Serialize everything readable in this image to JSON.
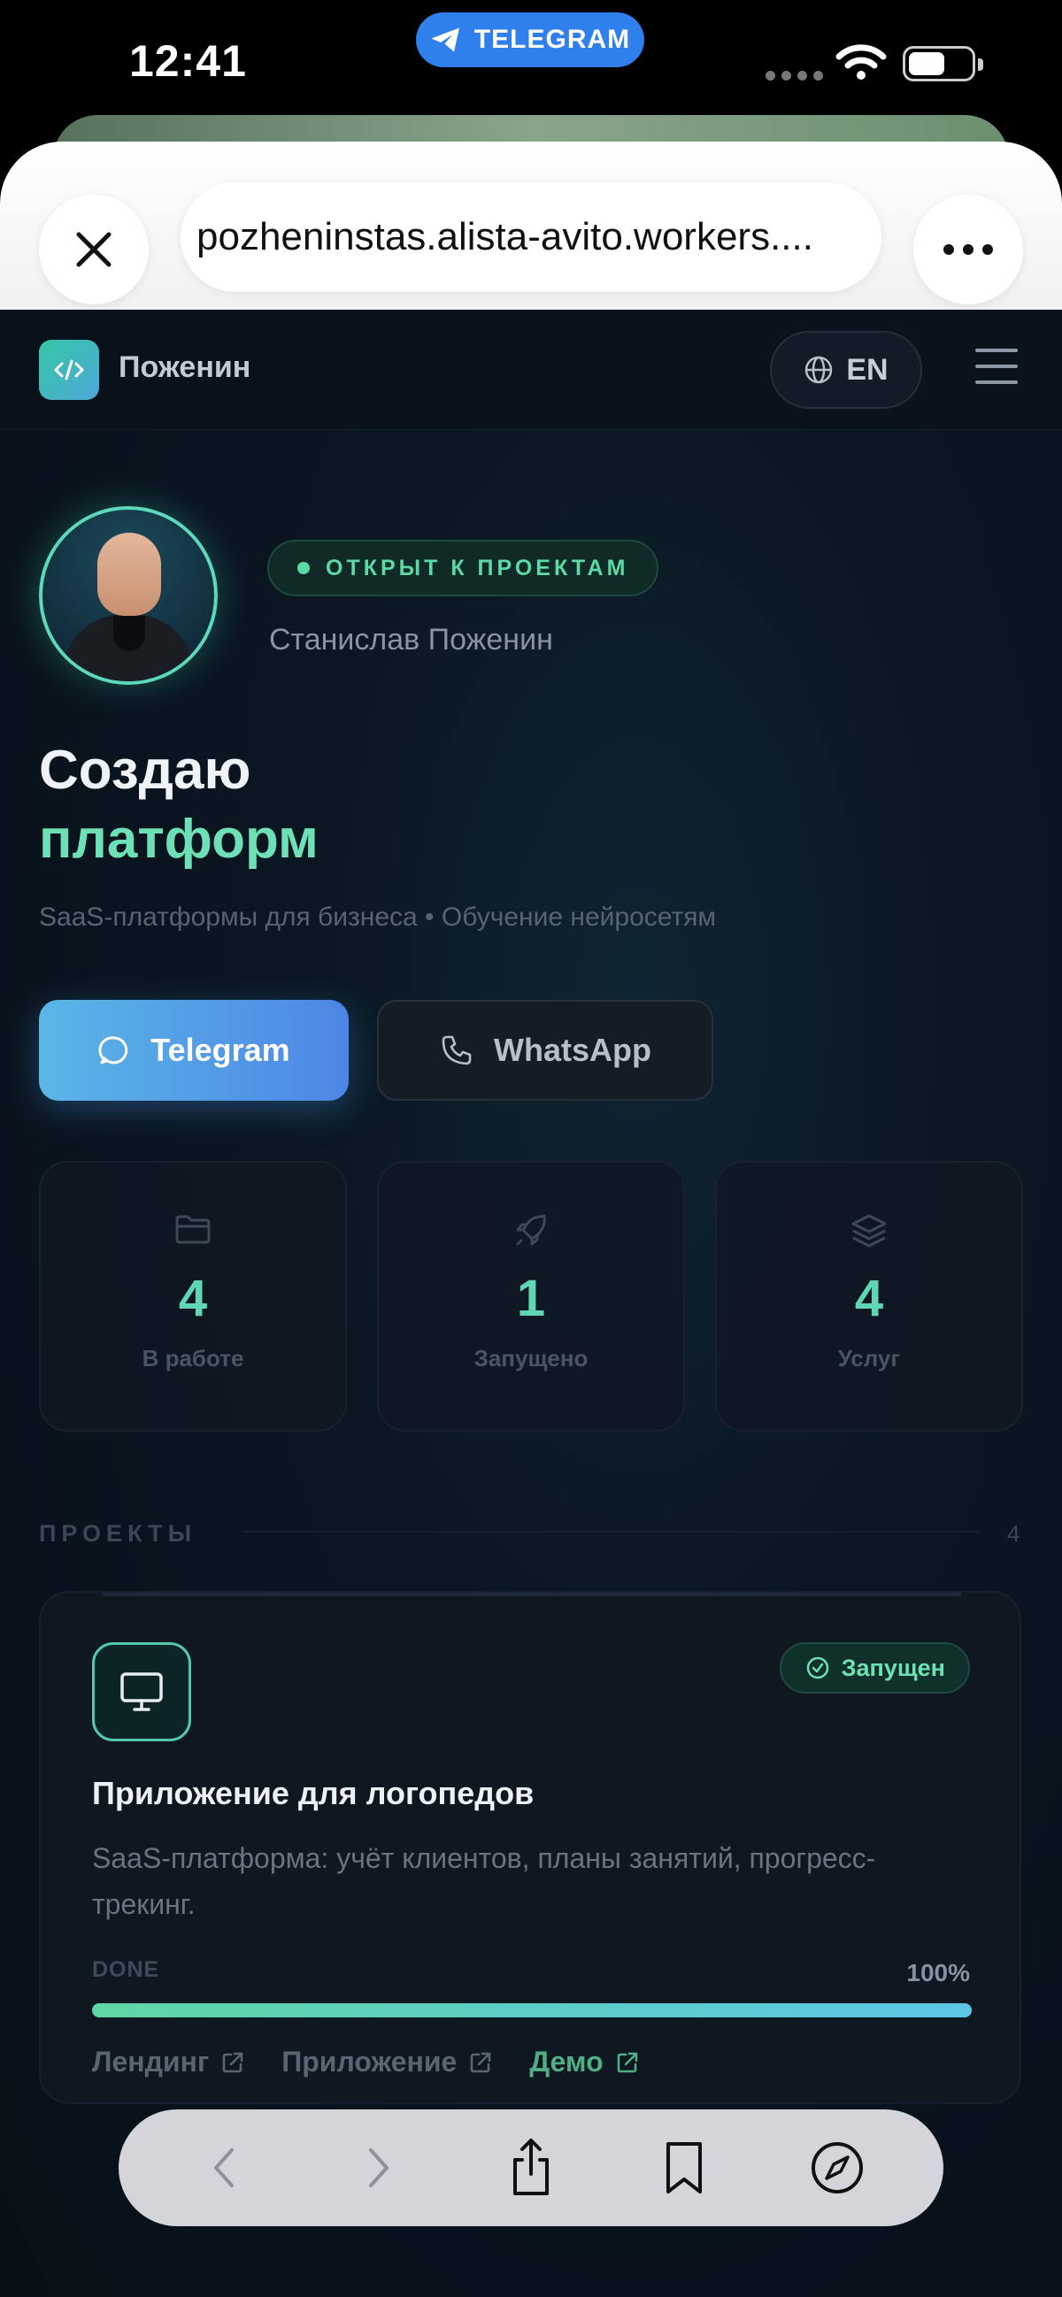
{
  "status_bar": {
    "time": "12:41",
    "app_pill": "TELEGRAM"
  },
  "browser": {
    "url": "pozheninstas.alista-avito.workers...."
  },
  "header": {
    "brand": "Поженин",
    "lang": "EN"
  },
  "hero": {
    "badge": "ОТКРЫТ К ПРОЕКТАМ",
    "name": "Станислав Поженин",
    "title": "Создаю",
    "accent": "платформ",
    "subtitle": "SaaS-платформы для бизнеса • Обучение нейросетям"
  },
  "cta": {
    "telegram": "Telegram",
    "whatsapp": "WhatsApp"
  },
  "stats": [
    {
      "value": "4",
      "label": "В работе",
      "icon": "folder-icon"
    },
    {
      "value": "1",
      "label": "Запущено",
      "icon": "rocket-icon"
    },
    {
      "value": "4",
      "label": "Услуг",
      "icon": "layers-icon"
    }
  ],
  "projects_section": {
    "label": "ПРОЕКТЫ",
    "count": "4"
  },
  "project": {
    "status": "Запущен",
    "title": "Приложение для логопедов",
    "description": "SaaS-платформа: учёт клиентов, планы занятий, прогресс-трекинг.",
    "progress_label": "DONE",
    "progress_text": "100%",
    "progress_value": 1.0,
    "links": [
      "Лендинг",
      "Приложение",
      "Демо"
    ]
  },
  "colors": {
    "accent": "#6ee0b6",
    "telegram_blue": "#4d86e6",
    "background": "#0a1621"
  }
}
